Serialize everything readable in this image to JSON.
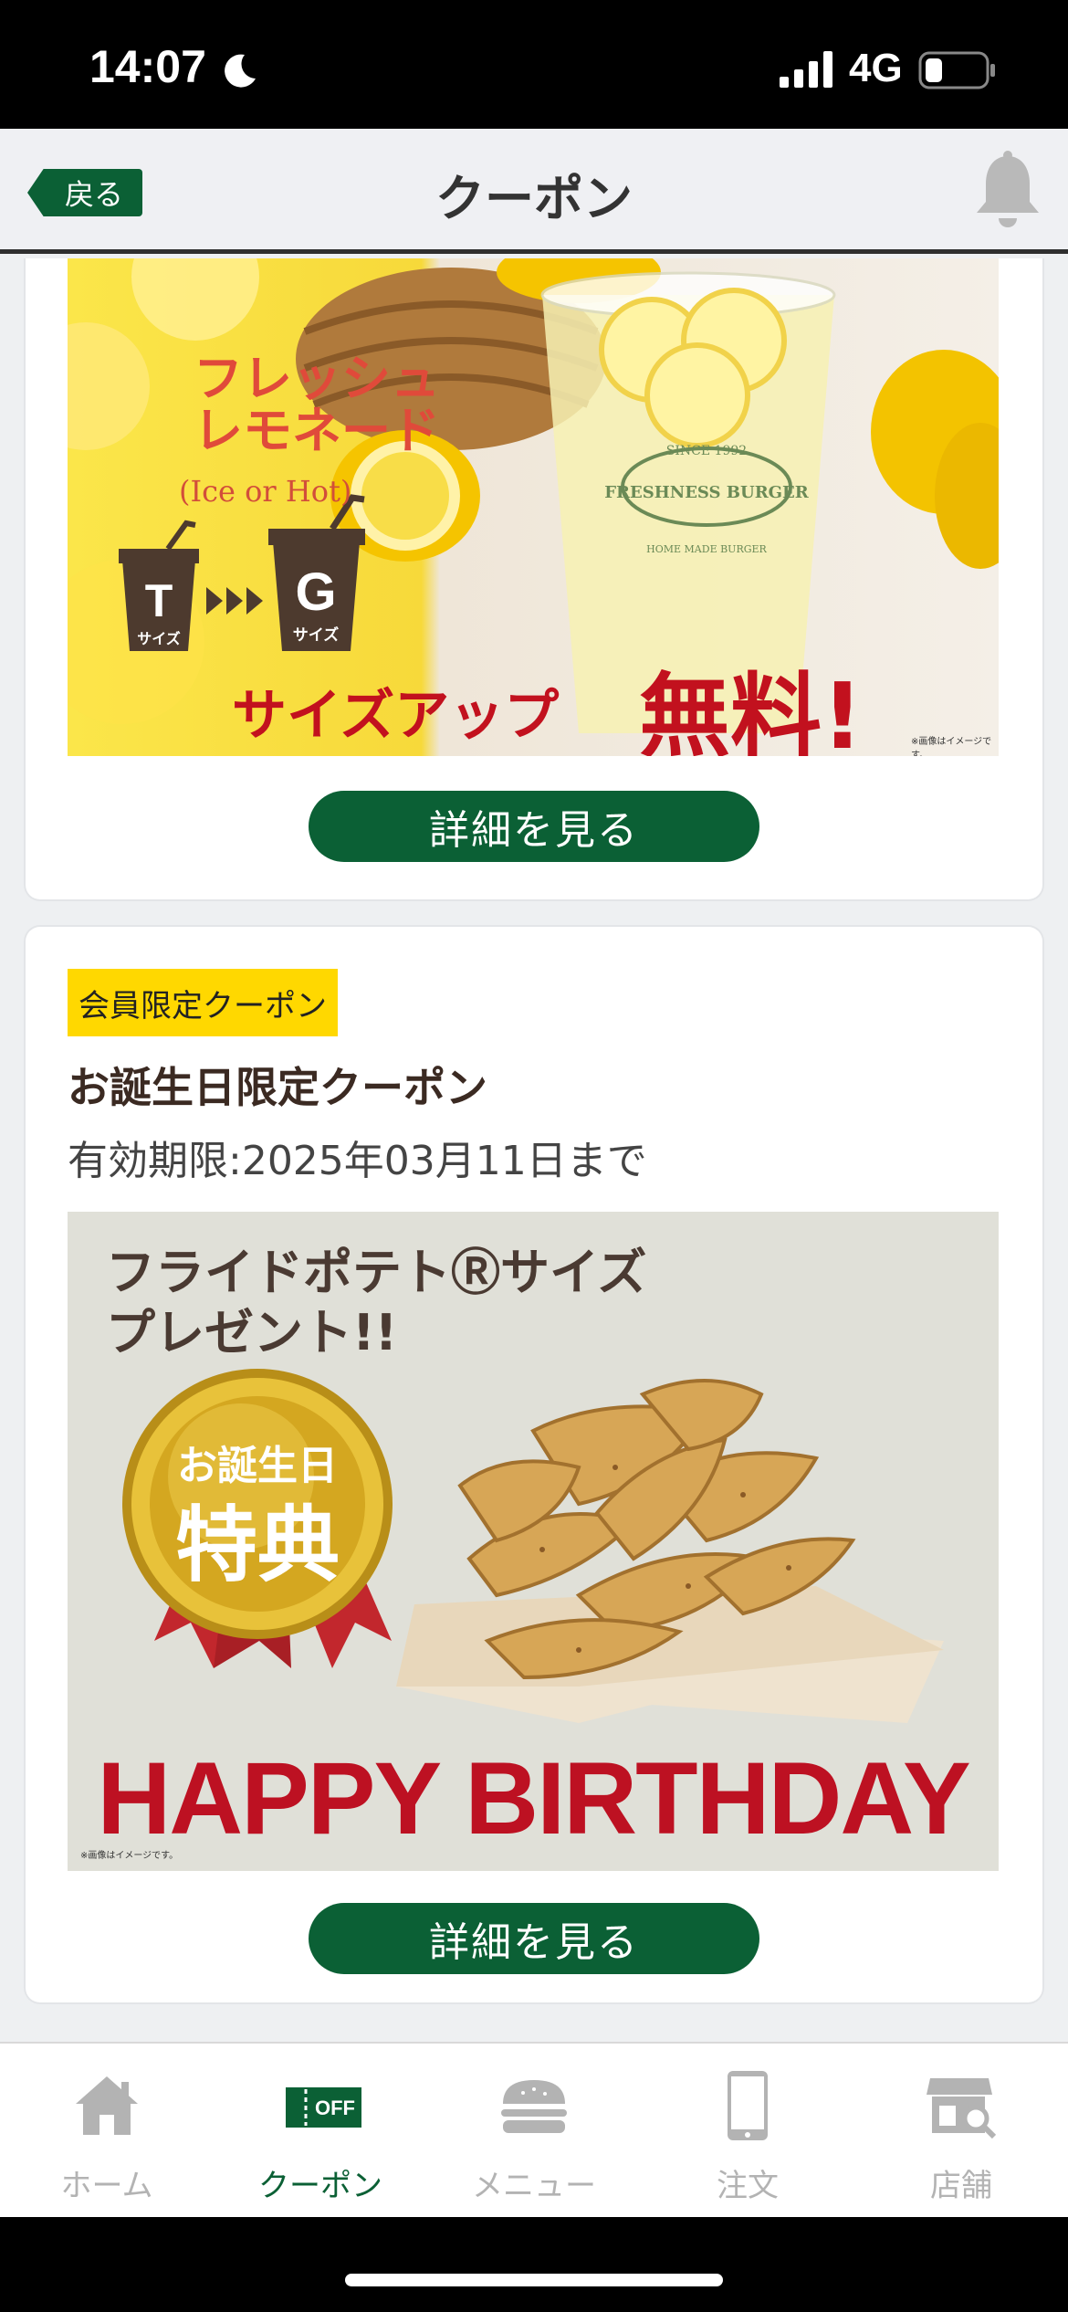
{
  "status_bar": {
    "time": "14:07",
    "network": "4G"
  },
  "nav": {
    "back_label": "戻る",
    "title": "クーポン"
  },
  "coupons": [
    {
      "banner": {
        "product_name": "フレッシュ\nレモネード",
        "product_option": "(Ice or Hot)",
        "size_from": "T",
        "size_to": "G",
        "size_word": "サイズ",
        "size_up": "サイズアップ",
        "free": "無料!",
        "note": "※画像はイメージです。",
        "cup_logo_top": "SINCE 1992",
        "cup_logo_main": "FRESHNESS BURGER",
        "cup_logo_sub": "HOME MADE BURGER"
      },
      "button_label": "詳細を見る"
    },
    {
      "tag": "会員限定クーポン",
      "title": "お誕生日限定クーポン",
      "expiry": "有効期限:2025年03月11日まで",
      "banner": {
        "headline_1": "フライドポテトⓇサイズ",
        "headline_2": "プレゼント!!",
        "medal_line_1": "お誕生日",
        "medal_line_2": "特典",
        "big_text": "HAPPY BIRTHDAY",
        "note": "※画像はイメージです。"
      },
      "button_label": "詳細を見る"
    }
  ],
  "tab_bar": {
    "items": [
      {
        "label": "ホーム",
        "icon": "home-icon",
        "active": false
      },
      {
        "label": "クーポン",
        "icon": "coupon-icon",
        "active": true
      },
      {
        "label": "メニュー",
        "icon": "burger-icon",
        "active": false
      },
      {
        "label": "注文",
        "icon": "phone-icon",
        "active": false
      },
      {
        "label": "店舗",
        "icon": "store-search-icon",
        "active": false
      }
    ],
    "coupon_icon_text": "OFF"
  },
  "colors": {
    "brand_green": "#0b6035",
    "tag_yellow": "#ffd800",
    "promo_red": "#c2111e",
    "inactive_gray": "#b3b3b3"
  }
}
